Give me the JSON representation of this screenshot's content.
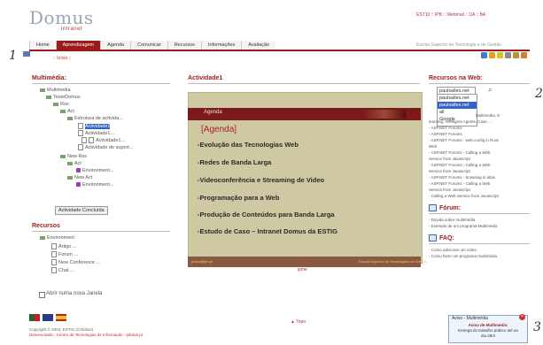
{
  "header": {
    "logo_main": "Domus",
    "logo_sub": "intranet",
    "top_links": "EST10 :: IPB :: Webmail :: DA :: BA",
    "tabs": [
      "Home",
      "Aprendizagem",
      "Agenda",
      "Comunicar",
      "Recursos",
      "Informações",
      "Avaliação"
    ],
    "active_tab": "Aprendizagem",
    "school": "Escola Superior de Tecnologia e de Gestão"
  },
  "breadcrumb": {
    "inicio": ":: Início ::"
  },
  "margin_numbers": {
    "one": "1",
    "two": "2",
    "three": "3"
  },
  "left": {
    "title": "Multimédia:",
    "tree": [
      "Multimedia",
      "TesteDomus",
      "Rss",
      "Act",
      "Estrutura de activida...",
      "Actividade1",
      "Actividade1...",
      "Actividade1...",
      "Actividade de suport...",
      "New Rss",
      "Act",
      "Environment...",
      "New Act",
      "Environment..."
    ],
    "button": "Actividade Concluída",
    "resources_title": "Recursos",
    "resources_tree": [
      "Environment",
      "Artigo ...",
      "Forum ...",
      "New Conference ...",
      "Chat ..."
    ],
    "checkbox_label": "Abrir numa nova Janela"
  },
  "center": {
    "title": "Actividade1",
    "slide": {
      "top_label": "Agenda",
      "heading": "[Agenda]",
      "bullets": [
        "-Evolução das Tecnologias Web",
        "-Redes de Banda Larga",
        "-Videoconferência e Streaming de Video",
        "-Programação para a Web",
        "-Produção de Conteúdos para Banda Larga",
        "-Estudo de Caso – Intranet Domus da ESTIG"
      ],
      "bottom_left": "pduro@ipb.pt",
      "bottom_right": "Escola Superior de Tecnologia e de Gestão",
      "bottom_center": "ipme"
    }
  },
  "right": {
    "title": "Recursos na Web:",
    "search_value": "paulsalles.net",
    "search_options": [
      "paulsalles.net",
      "paulsalles.net",
      "all",
      "Google"
    ],
    "web_links": [
      "Multimedia, E-",
      "learning, Intelligent Agents, Case ...",
      "- ASP.NET Forums",
      "- ASP.NET Forums",
      "- ASP.NET Forums - web.config in Root",
      "Web",
      "- ASP.NET Forums - Calling a Web",
      "Service from Javascript",
      "- ASP.NET Forums - Calling a Web",
      "Service from Javascript",
      "- ASP.NET Forums - browsing in atlas",
      "- ASP.NET Forums - Calling a Web",
      "Service from Javascript",
      "- Calling a Web Service from Javascript"
    ],
    "forum_title": "Fórum:",
    "forum_links": [
      "- Dúvida sobre multimédia",
      "- Exemplo de um programa Multimédia"
    ],
    "faq_title": "FAQ:",
    "faq_links": [
      "- Como adicionar um vídeo",
      "- Como fazer um programa multimédia"
    ]
  },
  "footer": {
    "copyright": "Copyright © 2003, ESTIG (Créditos)",
    "developed": "Desenvolvido : Centro de Tecnologias de Informação - ipbdub.pt",
    "topo": "▲ Topo",
    "notify_title": "Aviso - Multimédia",
    "notify_heading": "Aviso de Multimédia:",
    "notify_body": "Entrega do trabalho prático até ao dia 28/4"
  },
  "colors": {
    "accent": "#9b1b1b",
    "slide_bg": "#cec9a2",
    "slide_bar": "#7a1a1a"
  }
}
